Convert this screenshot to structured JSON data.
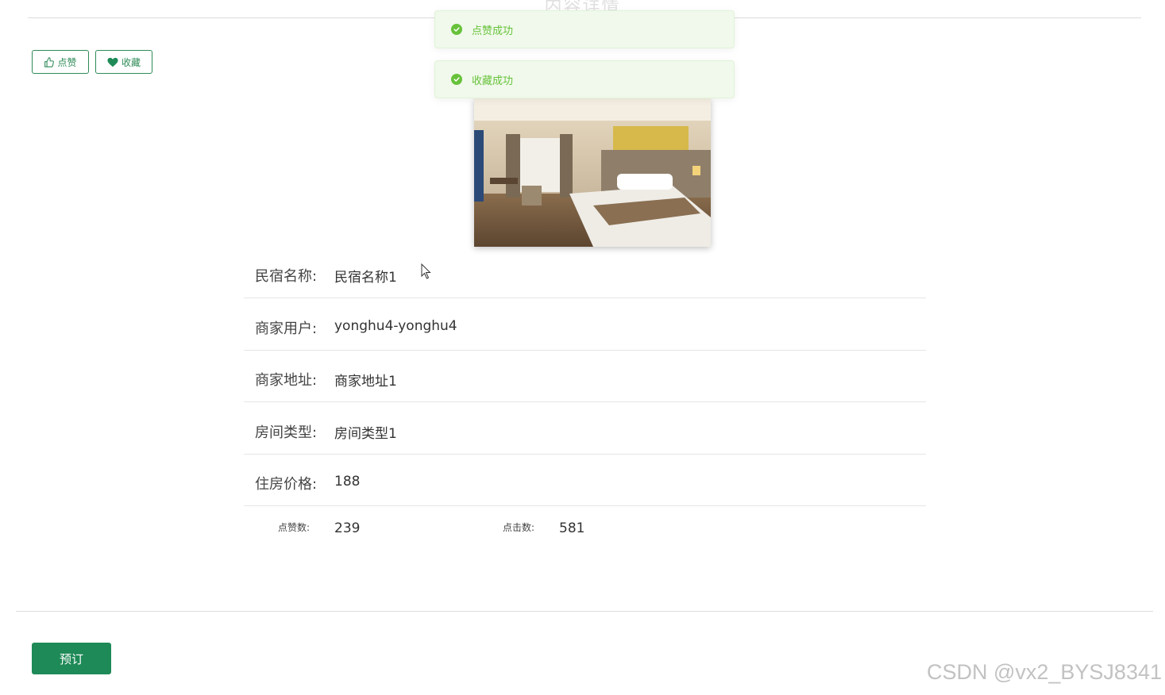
{
  "page": {
    "title": "内容详情"
  },
  "actions": {
    "like_label": "点赞",
    "favorite_label": "收藏"
  },
  "toasts": [
    {
      "message": "点赞成功"
    },
    {
      "message": "收藏成功"
    }
  ],
  "details": [
    {
      "label": "民宿名称:",
      "value": "民宿名称1"
    },
    {
      "label": "商家用户:",
      "value": "yonghu4-yonghu4"
    },
    {
      "label": "商家地址:",
      "value": "商家地址1"
    },
    {
      "label": "房间类型:",
      "value": "房间类型1"
    },
    {
      "label": "住房价格:",
      "value": "188"
    }
  ],
  "stats": {
    "likes_label": "点赞数:",
    "likes_value": "239",
    "clicks_label": "点击数:",
    "clicks_value": "581"
  },
  "booking": {
    "button_label": "预订"
  },
  "watermark": "CSDN @vx2_BYSJ8341",
  "colors": {
    "primary": "#1e8a57",
    "success": "#67c23a",
    "toast_bg": "#f0f9eb"
  }
}
